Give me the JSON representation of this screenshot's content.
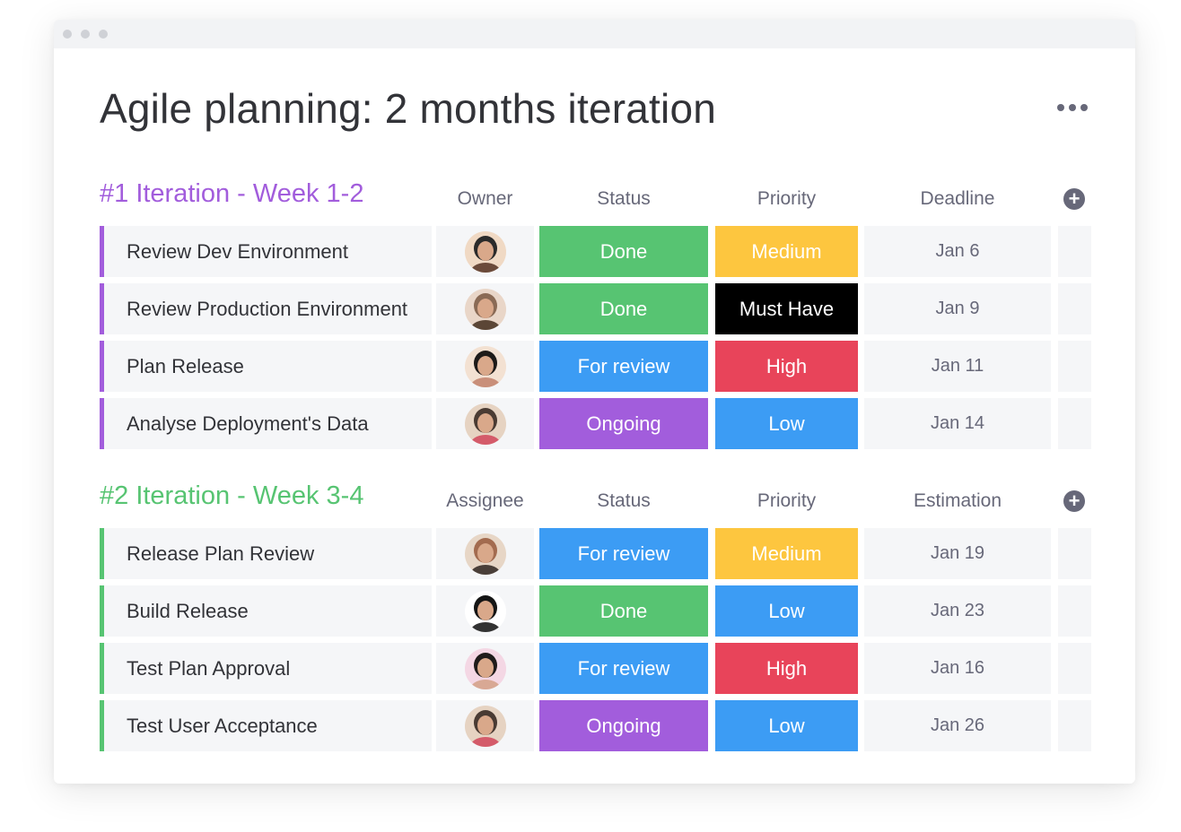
{
  "board": {
    "title": "Agile planning: 2 months iteration"
  },
  "colors": {
    "done": "#57c472",
    "for_review": "#3c9cf4",
    "ongoing": "#a25ddc",
    "medium": "#fdc63f",
    "must_have": "#000000",
    "high": "#e8445a",
    "low": "#3c9cf4",
    "group1_accent": "#a25ddc",
    "group2_accent": "#57c472"
  },
  "groups": [
    {
      "title": "#1 Iteration - Week 1-2",
      "color": "#a25ddc",
      "columns": {
        "owner": "Owner",
        "status": "Status",
        "priority": "Priority",
        "date": "Deadline"
      },
      "rows": [
        {
          "name": "Review Dev Environment",
          "status": "Done",
          "status_color": "#57c472",
          "priority": "Medium",
          "priority_color": "#fdc63f",
          "date": "Jan 6"
        },
        {
          "name": "Review Production Environment",
          "status": "Done",
          "status_color": "#57c472",
          "priority": "Must Have",
          "priority_color": "#000000",
          "date": "Jan 9"
        },
        {
          "name": "Plan Release",
          "status": "For review",
          "status_color": "#3c9cf4",
          "priority": "High",
          "priority_color": "#e8445a",
          "date": "Jan 11"
        },
        {
          "name": "Analyse Deployment's Data",
          "status": "Ongoing",
          "status_color": "#a25ddc",
          "priority": "Low",
          "priority_color": "#3c9cf4",
          "date": "Jan 14"
        }
      ]
    },
    {
      "title": "#2 Iteration - Week 3-4",
      "color": "#57c472",
      "columns": {
        "owner": "Assignee",
        "status": "Status",
        "priority": "Priority",
        "date": "Estimation"
      },
      "rows": [
        {
          "name": "Release Plan Review",
          "status": "For review",
          "status_color": "#3c9cf4",
          "priority": "Medium",
          "priority_color": "#fdc63f",
          "date": "Jan 19"
        },
        {
          "name": "Build Release",
          "status": "Done",
          "status_color": "#57c472",
          "priority": "Low",
          "priority_color": "#3c9cf4",
          "date": "Jan 23"
        },
        {
          "name": "Test Plan Approval",
          "status": "For review",
          "status_color": "#3c9cf4",
          "priority": "High",
          "priority_color": "#e8445a",
          "date": "Jan 16"
        },
        {
          "name": "Test User Acceptance",
          "status": "Ongoing",
          "status_color": "#a25ddc",
          "priority": "Low",
          "priority_color": "#3c9cf4",
          "date": "Jan 26"
        }
      ]
    }
  ]
}
